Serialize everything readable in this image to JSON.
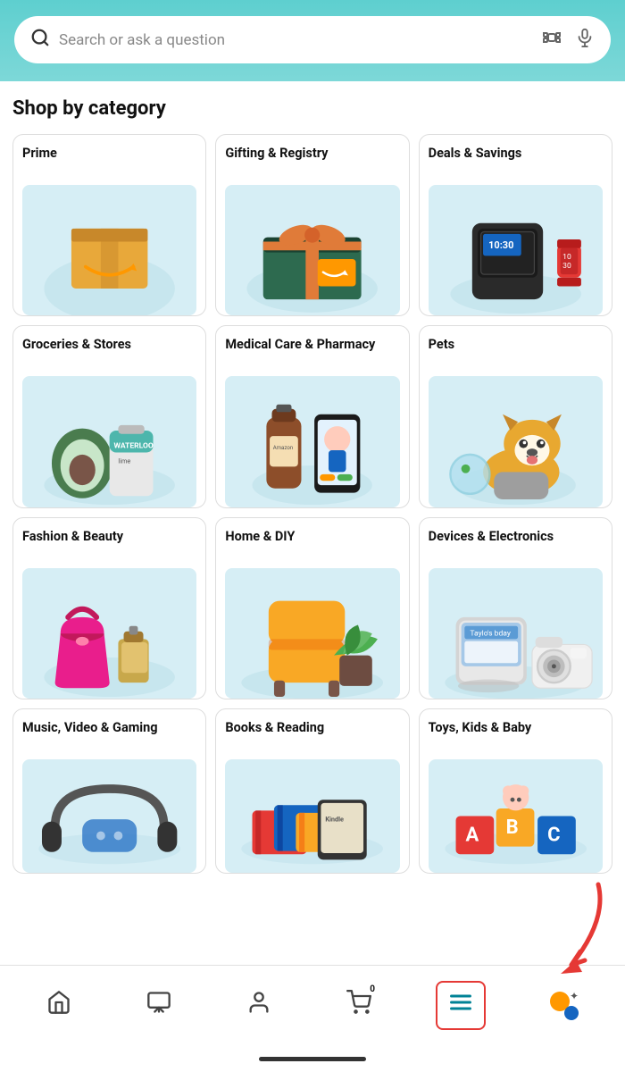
{
  "header": {
    "search_placeholder": "Search or ask a question",
    "bg_color": "#5ecfcf"
  },
  "main": {
    "section_title": "Shop by category",
    "categories": [
      {
        "id": "prime",
        "title": "Prime",
        "image_type": "prime"
      },
      {
        "id": "gifting",
        "title": "Gifting & Registry",
        "image_type": "gifting"
      },
      {
        "id": "deals",
        "title": "Deals & Savings",
        "image_type": "deals"
      },
      {
        "id": "groceries",
        "title": "Groceries & Stores",
        "image_type": "groceries"
      },
      {
        "id": "medical",
        "title": "Medical Care & Pharmacy",
        "image_type": "medical"
      },
      {
        "id": "pets",
        "title": "Pets",
        "image_type": "pets"
      },
      {
        "id": "fashion",
        "title": "Fashion & Beauty",
        "image_type": "fashion"
      },
      {
        "id": "home",
        "title": "Home & DIY",
        "image_type": "home"
      },
      {
        "id": "devices",
        "title": "Devices & Electronics",
        "image_type": "devices"
      },
      {
        "id": "music",
        "title": "Music, Video & Gaming",
        "image_type": "music"
      },
      {
        "id": "books",
        "title": "Books & Reading",
        "image_type": "books"
      },
      {
        "id": "toys",
        "title": "Toys, Kids & Baby",
        "image_type": "toys"
      }
    ]
  },
  "bottom_nav": {
    "items": [
      {
        "id": "home",
        "label": "Home",
        "icon": "home"
      },
      {
        "id": "video",
        "label": "Video",
        "icon": "play"
      },
      {
        "id": "account",
        "label": "Account",
        "icon": "person"
      },
      {
        "id": "cart",
        "label": "Cart",
        "icon": "cart",
        "badge": "0"
      },
      {
        "id": "menu",
        "label": "Menu",
        "icon": "menu",
        "active": true
      },
      {
        "id": "ai",
        "label": "AI",
        "icon": "ai"
      }
    ]
  }
}
